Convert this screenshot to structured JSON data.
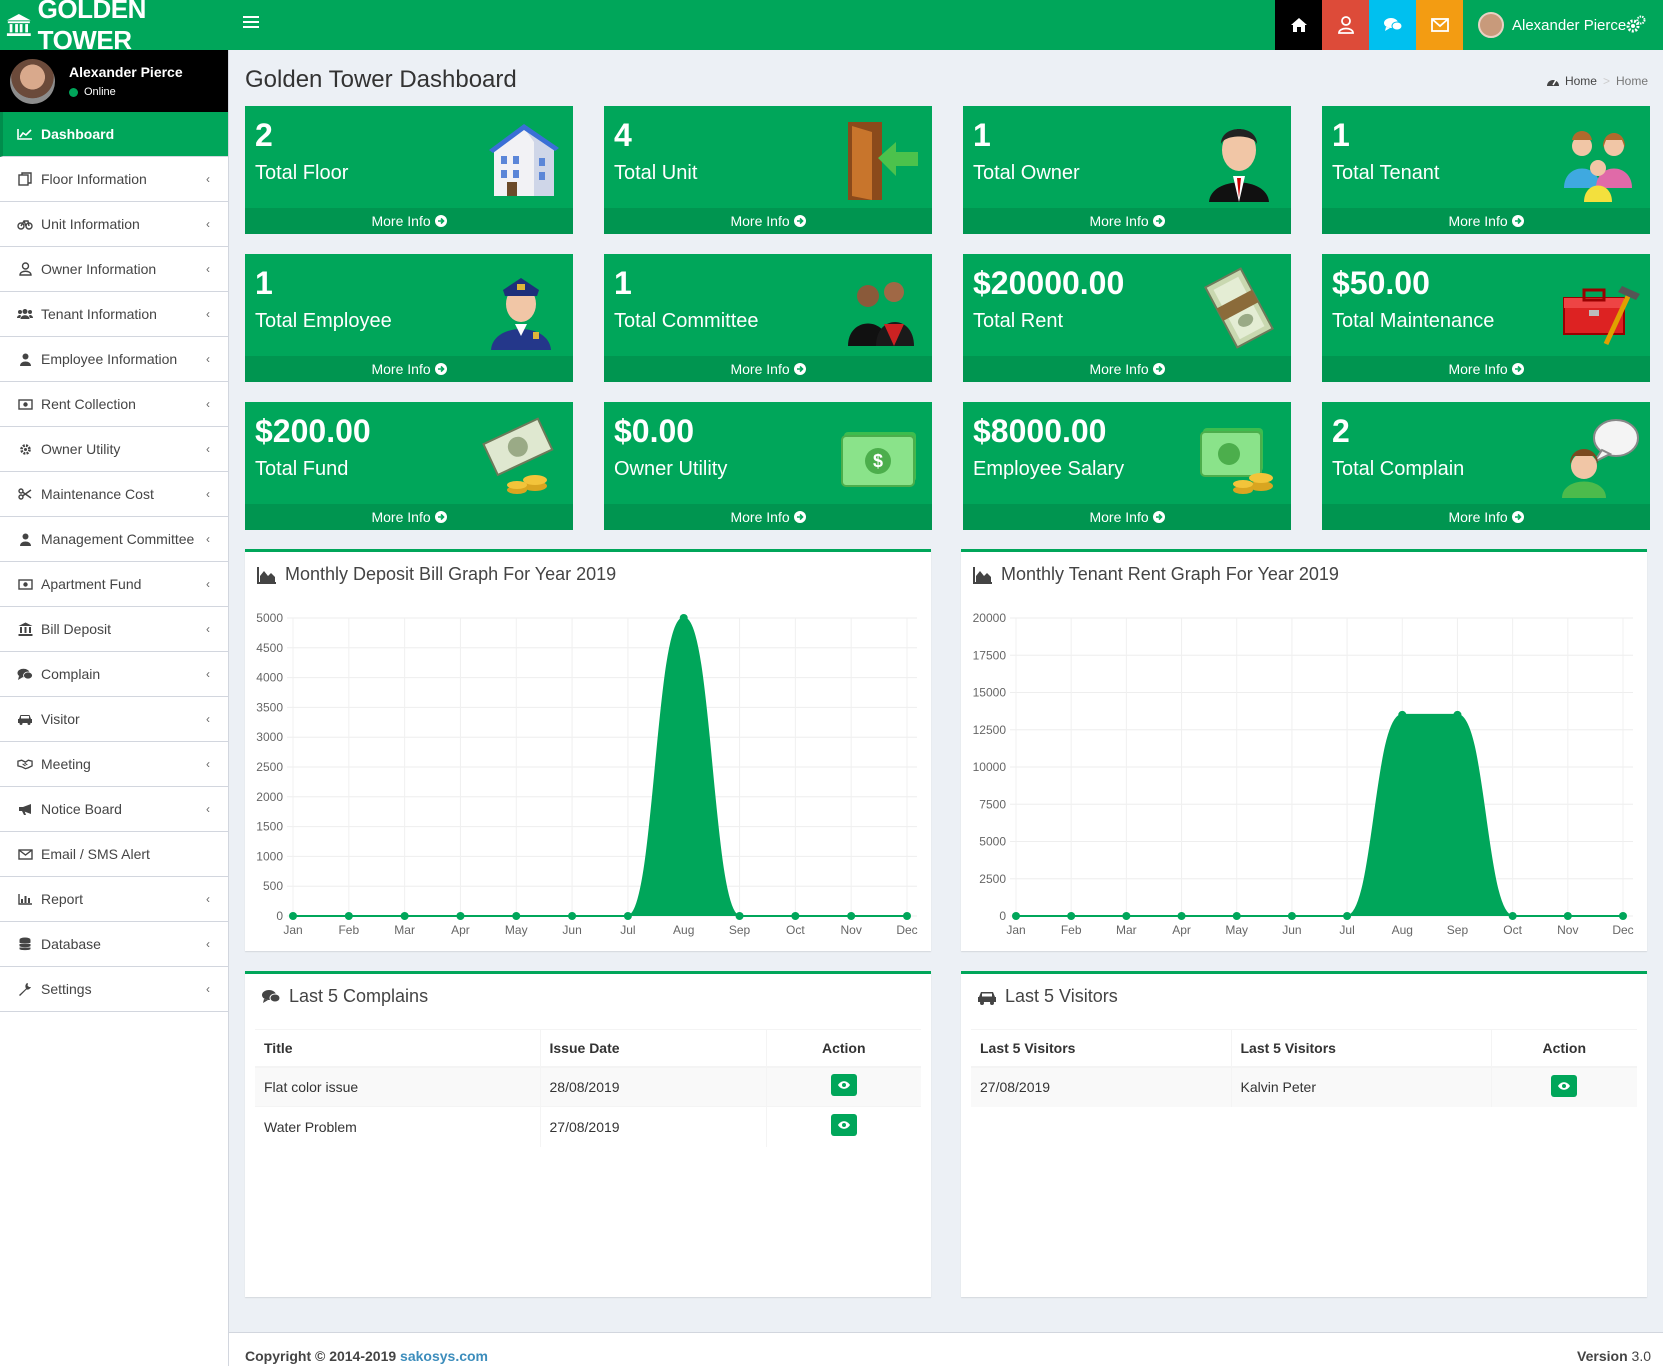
{
  "app": {
    "title": "GOLDEN TOWER",
    "brand_color": "#00a65a"
  },
  "header": {
    "user_name": "Alexander Pierce",
    "buttons": [
      {
        "name": "home",
        "color": "#000000"
      },
      {
        "name": "user",
        "color": "#dd4b39"
      },
      {
        "name": "comments",
        "color": "#00c0ef"
      },
      {
        "name": "envelope",
        "color": "#f39c12"
      }
    ]
  },
  "sidebar": {
    "user": {
      "name": "Alexander Pierce",
      "status": "Online"
    },
    "items": [
      {
        "label": "Dashboard",
        "icon": "line-chart-icon"
      },
      {
        "label": "Floor Information",
        "icon": "copy-icon"
      },
      {
        "label": "Unit Information",
        "icon": "bicycle-icon"
      },
      {
        "label": "Owner Information",
        "icon": "user-outline-icon"
      },
      {
        "label": "Tenant Information",
        "icon": "users-icon"
      },
      {
        "label": "Employee Information",
        "icon": "user-icon"
      },
      {
        "label": "Rent Collection",
        "icon": "money-icon"
      },
      {
        "label": "Owner Utility",
        "icon": "gear-icon"
      },
      {
        "label": "Maintenance Cost",
        "icon": "scissors-icon"
      },
      {
        "label": "Management Committee",
        "icon": "user-icon"
      },
      {
        "label": "Apartment Fund",
        "icon": "money-icon"
      },
      {
        "label": "Bill Deposit",
        "icon": "bank-icon"
      },
      {
        "label": "Complain",
        "icon": "comments-icon"
      },
      {
        "label": "Visitor",
        "icon": "car-icon"
      },
      {
        "label": "Meeting",
        "icon": "handshake-icon"
      },
      {
        "label": "Notice Board",
        "icon": "bullhorn-icon"
      },
      {
        "label": "Email / SMS Alert",
        "icon": "envelope-icon"
      },
      {
        "label": "Report",
        "icon": "bar-chart-icon"
      },
      {
        "label": "Database",
        "icon": "database-icon"
      },
      {
        "label": "Settings",
        "icon": "wrench-icon"
      }
    ]
  },
  "page": {
    "title": "Golden Tower Dashboard",
    "breadcrumb_home": "Home",
    "breadcrumb_current": "Home"
  },
  "boxes": [
    {
      "value": "2",
      "label": "Total Floor",
      "more": "More Info",
      "icon": "building-icon"
    },
    {
      "value": "4",
      "label": "Total Unit",
      "more": "More Info",
      "icon": "door-icon"
    },
    {
      "value": "1",
      "label": "Total Owner",
      "more": "More Info",
      "icon": "owner-icon"
    },
    {
      "value": "1",
      "label": "Total Tenant",
      "more": "More Info",
      "icon": "family-icon"
    },
    {
      "value": "1",
      "label": "Total Employee",
      "more": "More Info",
      "icon": "police-icon"
    },
    {
      "value": "1",
      "label": "Total Committee",
      "more": "More Info",
      "icon": "committee-icon"
    },
    {
      "value": "$20000.00",
      "label": "Total Rent",
      "more": "More Info",
      "icon": "cash-stack-icon"
    },
    {
      "value": "$50.00",
      "label": "Total Maintenance",
      "more": "More Info",
      "icon": "toolbox-icon"
    },
    {
      "value": "$200.00",
      "label": "Total Fund",
      "more": "More Info",
      "icon": "money-coins-icon"
    },
    {
      "value": "$0.00",
      "label": "Owner Utility",
      "more": "More Info",
      "icon": "green-money-icon"
    },
    {
      "value": "$8000.00",
      "label": "Employee Salary",
      "more": "More Info",
      "icon": "money-gold-icon"
    },
    {
      "value": "2",
      "label": "Total Complain",
      "more": "More Info",
      "icon": "speech-user-icon"
    }
  ],
  "charts": {
    "deposit": {
      "title": "Monthly Deposit Bill Graph For Year 2019"
    },
    "rent": {
      "title": "Monthly Tenant Rent Graph For Year 2019"
    }
  },
  "chart_data": [
    {
      "type": "area",
      "title": "Monthly Deposit Bill Graph For Year 2019",
      "categories": [
        "Jan",
        "Feb",
        "Mar",
        "Apr",
        "May",
        "Jun",
        "Jul",
        "Aug",
        "Sep",
        "Oct",
        "Nov",
        "Dec"
      ],
      "values": [
        0,
        0,
        0,
        0,
        0,
        0,
        0,
        5000,
        0,
        0,
        0,
        0
      ],
      "yticks": [
        "5000",
        "4500",
        "4000",
        "3500",
        "3000",
        "2500",
        "2000",
        "1500",
        "1000",
        "500",
        "0"
      ],
      "ylim": [
        0,
        5000
      ],
      "color": "#00a65a"
    },
    {
      "type": "area",
      "title": "Monthly Tenant Rent Graph For Year 2019",
      "categories": [
        "Jan",
        "Feb",
        "Mar",
        "Apr",
        "May",
        "Jun",
        "Jul",
        "Aug",
        "Sep",
        "Oct",
        "Nov",
        "Dec"
      ],
      "values": [
        0,
        0,
        0,
        0,
        0,
        0,
        0,
        13500,
        13500,
        0,
        0,
        0
      ],
      "yticks": [
        "20000",
        "17500",
        "15000",
        "12500",
        "10000",
        "7500",
        "5000",
        "2500",
        "0"
      ],
      "ylim": [
        0,
        20000
      ],
      "color": "#00a65a"
    }
  ],
  "complains": {
    "title": "Last 5 Complains",
    "headers": [
      "Title",
      "Issue Date",
      "Action"
    ],
    "rows": [
      {
        "title": "Flat color issue",
        "date": "28/08/2019"
      },
      {
        "title": "Water Problem",
        "date": "27/08/2019"
      }
    ]
  },
  "visitors": {
    "title": "Last 5 Visitors",
    "headers": [
      "Last 5 Visitors",
      "Last 5 Visitors",
      "Action"
    ],
    "rows": [
      {
        "date": "27/08/2019",
        "name": "Kalvin Peter"
      }
    ]
  },
  "footer": {
    "copyright": "Copyright © 2014-2019",
    "link": "sakosys.com",
    "version_label": "Version",
    "version": "3.0"
  }
}
